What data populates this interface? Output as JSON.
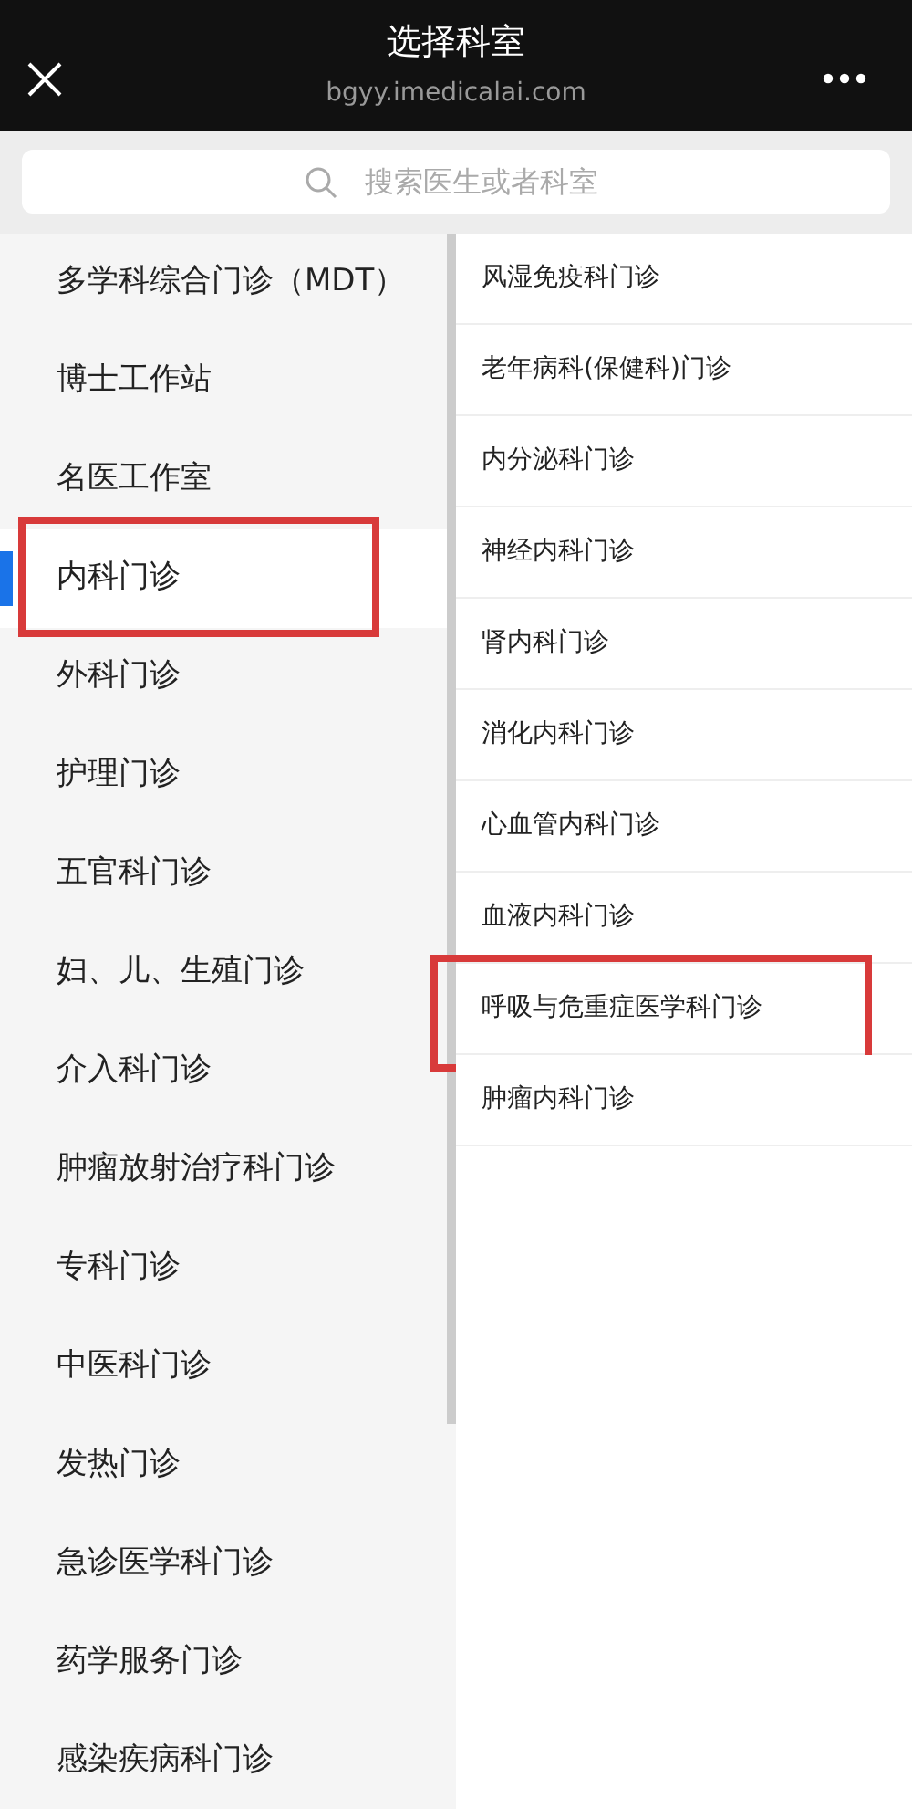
{
  "header": {
    "title": "选择科室",
    "subtitle": "bgyy.imedicalai.com"
  },
  "search": {
    "placeholder": "搜索医生或者科室"
  },
  "departments": [
    {
      "label": "多学科综合门诊（MDT）",
      "selected": false,
      "highlighted": false
    },
    {
      "label": "博士工作站",
      "selected": false,
      "highlighted": false
    },
    {
      "label": "名医工作室",
      "selected": false,
      "highlighted": false
    },
    {
      "label": "内科门诊",
      "selected": true,
      "highlighted": true
    },
    {
      "label": "外科门诊",
      "selected": false,
      "highlighted": false
    },
    {
      "label": "护理门诊",
      "selected": false,
      "highlighted": false
    },
    {
      "label": "五官科门诊",
      "selected": false,
      "highlighted": false
    },
    {
      "label": "妇、儿、生殖门诊",
      "selected": false,
      "highlighted": false
    },
    {
      "label": "介入科门诊",
      "selected": false,
      "highlighted": false
    },
    {
      "label": "肿瘤放射治疗科门诊",
      "selected": false,
      "highlighted": false
    },
    {
      "label": "专科门诊",
      "selected": false,
      "highlighted": false
    },
    {
      "label": "中医科门诊",
      "selected": false,
      "highlighted": false
    },
    {
      "label": "发热门诊",
      "selected": false,
      "highlighted": false
    },
    {
      "label": "急诊医学科门诊",
      "selected": false,
      "highlighted": false
    },
    {
      "label": "药学服务门诊",
      "selected": false,
      "highlighted": false
    },
    {
      "label": "感染疾病科门诊",
      "selected": false,
      "highlighted": false
    }
  ],
  "clinics": [
    {
      "label": "风湿免疫科门诊",
      "highlighted": false
    },
    {
      "label": "老年病科(保健科)门诊",
      "highlighted": false
    },
    {
      "label": "内分泌科门诊",
      "highlighted": false
    },
    {
      "label": "神经内科门诊",
      "highlighted": false
    },
    {
      "label": "肾内科门诊",
      "highlighted": false
    },
    {
      "label": "消化内科门诊",
      "highlighted": false
    },
    {
      "label": "心血管内科门诊",
      "highlighted": false
    },
    {
      "label": "血液内科门诊",
      "highlighted": false
    },
    {
      "label": "呼吸与危重症医学科门诊",
      "highlighted": true
    },
    {
      "label": "肿瘤内科门诊",
      "highlighted": false
    }
  ]
}
